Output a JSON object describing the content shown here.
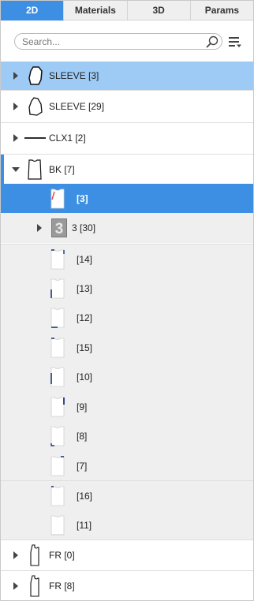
{
  "tabs": [
    {
      "label": "2D",
      "active": true
    },
    {
      "label": "Materials",
      "active": false
    },
    {
      "label": "3D",
      "active": false
    },
    {
      "label": "Params",
      "active": false
    }
  ],
  "search": {
    "placeholder": "Search...",
    "value": ""
  },
  "icons": {
    "search": "search-icon",
    "menu": "list-menu-icon"
  },
  "colors": {
    "accent": "#3d8fe3",
    "selected_light": "#9ecbf6",
    "group_bg": "#efefef",
    "trim": "#1b3a73"
  },
  "tree": [
    {
      "label": "SLEEVE [3]",
      "icon": "sleeve-piece-icon",
      "expandable": true,
      "selected": "light"
    },
    {
      "label": "SLEEVE [29]",
      "icon": "sleeve-piece-icon",
      "expandable": true
    },
    {
      "label": "CLX1 [2]",
      "icon": "line-piece-icon",
      "expandable": true
    },
    {
      "label": "BK [7]",
      "icon": "bodice-piece-icon",
      "expandable": true,
      "expanded": true
    },
    {
      "label": "[3]",
      "icon": "bodice-thumb-icon",
      "selected": "strong"
    },
    {
      "label": "3 [30]",
      "icon": "group-number-icon",
      "expandable": true,
      "badge": "3"
    },
    {
      "label": "[14]",
      "icon": "bodice-thumb-icon"
    },
    {
      "label": "[13]",
      "icon": "bodice-thumb-icon"
    },
    {
      "label": "[12]",
      "icon": "bodice-thumb-icon"
    },
    {
      "label": "[15]",
      "icon": "bodice-thumb-icon"
    },
    {
      "label": "[10]",
      "icon": "bodice-thumb-icon"
    },
    {
      "label": "[9]",
      "icon": "bodice-thumb-icon"
    },
    {
      "label": "[8]",
      "icon": "bodice-thumb-icon"
    },
    {
      "label": "[7]",
      "icon": "bodice-thumb-icon"
    },
    {
      "label": "[16]",
      "icon": "bodice-thumb-icon"
    },
    {
      "label": "[11]",
      "icon": "bodice-thumb-icon"
    },
    {
      "label": "FR [0]",
      "icon": "front-piece-icon",
      "expandable": true
    },
    {
      "label": "FR [8]",
      "icon": "front-piece-icon",
      "expandable": true
    }
  ]
}
